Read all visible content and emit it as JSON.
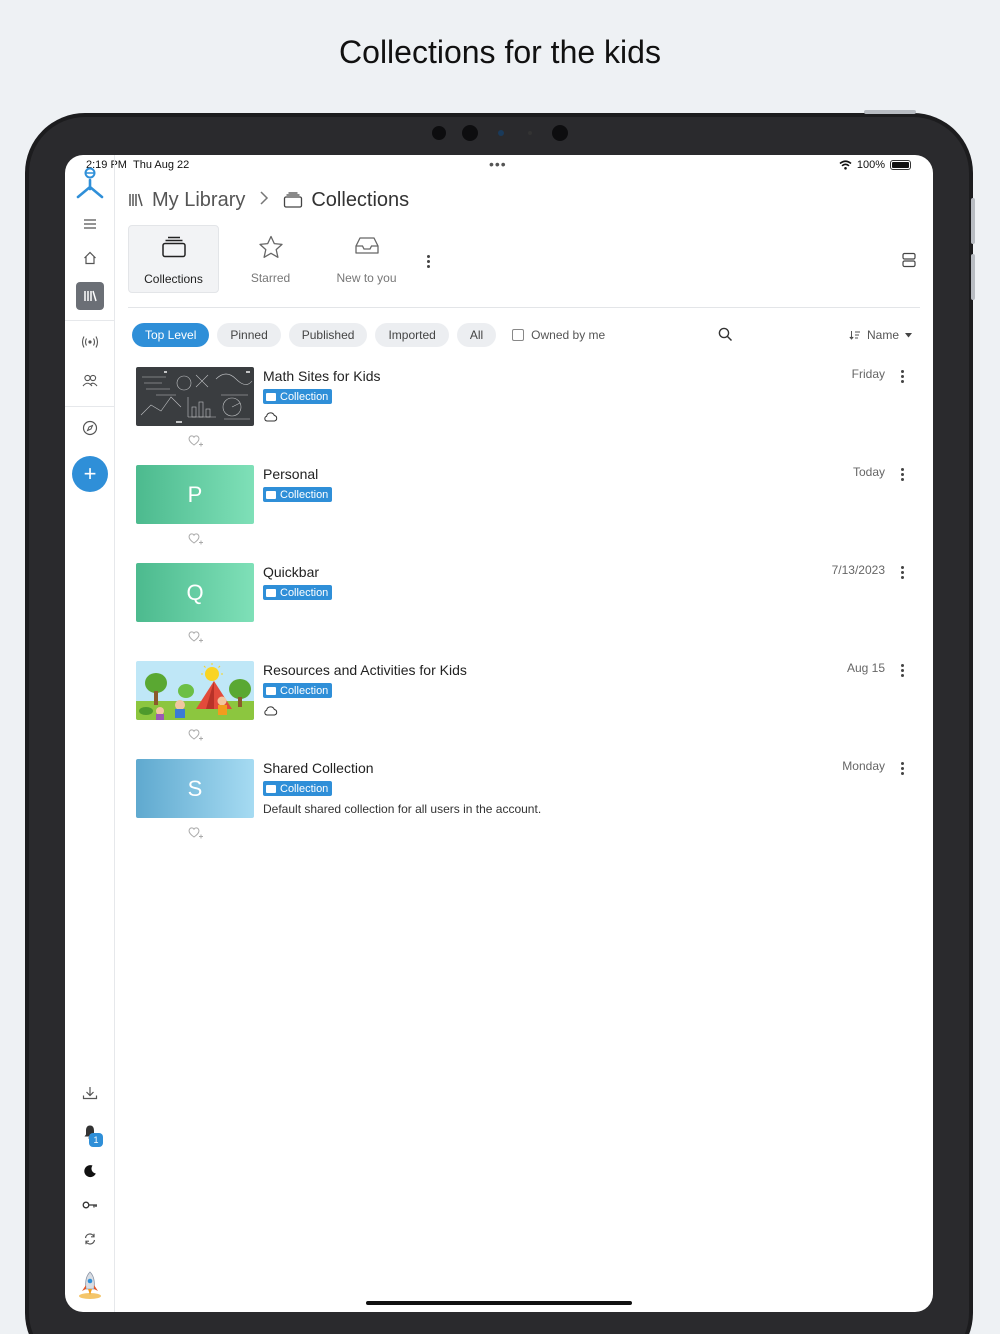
{
  "headline": "Collections for the kids",
  "status": {
    "time": "2:19 PM",
    "date": "Thu Aug 22",
    "battery": "100%"
  },
  "breadcrumb": {
    "root": "My Library",
    "current": "Collections"
  },
  "tabs": [
    {
      "label": "Collections",
      "active": true
    },
    {
      "label": "Starred",
      "active": false
    },
    {
      "label": "New to you",
      "active": false
    }
  ],
  "filters": {
    "chips": [
      {
        "label": "Top Level",
        "active": true
      },
      {
        "label": "Pinned",
        "active": false
      },
      {
        "label": "Published",
        "active": false
      },
      {
        "label": "Imported",
        "active": false
      },
      {
        "label": "All",
        "active": false
      }
    ],
    "owned_by_me": "Owned by me",
    "sort_label": "Name"
  },
  "items": [
    {
      "title": "Math Sites for Kids",
      "tag": "Collection",
      "date": "Friday",
      "thumb": "chalkboard-image",
      "cloud": true,
      "description": ""
    },
    {
      "title": "Personal",
      "tag": "Collection",
      "date": "Today",
      "thumb_letter": "P",
      "thumb_color": "green",
      "cloud": false,
      "description": ""
    },
    {
      "title": "Quickbar",
      "tag": "Collection",
      "date": "7/13/2023",
      "thumb_letter": "Q",
      "thumb_color": "green",
      "cloud": false,
      "description": ""
    },
    {
      "title": "Resources and Activities for Kids",
      "tag": "Collection",
      "date": "Aug 15",
      "thumb": "kids-camping-image",
      "cloud": true,
      "description": ""
    },
    {
      "title": "Shared Collection",
      "tag": "Collection",
      "date": "Monday",
      "thumb_letter": "S",
      "thumb_color": "blue",
      "cloud": false,
      "description": "Default shared collection for all users in the account."
    }
  ],
  "notifications": {
    "badge": "1"
  },
  "colors": {
    "accent": "#2f8fd8",
    "sidebar_active": "#6b6f76"
  }
}
